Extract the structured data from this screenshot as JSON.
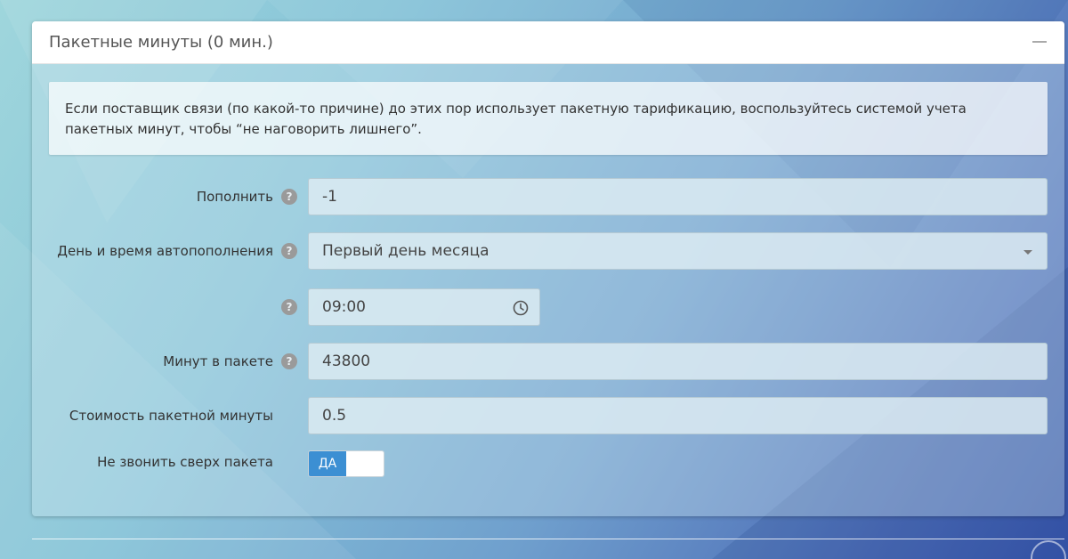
{
  "panel": {
    "title": "Пакетные минуты (0 мин.)",
    "info_text": "Если поставщик связи (по какой-то причине) до этих пор использует пакетную тарификацию, воспользуйтесь системой учета пакетных минут, чтобы “не наговорить лишнего”."
  },
  "form": {
    "replenish": {
      "label": "Пополнить",
      "value": "-1"
    },
    "auto_replenish": {
      "label": "День и время автопополнения",
      "value": "Первый день месяца"
    },
    "time": {
      "value": "09:00"
    },
    "minutes_in_package": {
      "label": "Минут в пакете",
      "value": "43800"
    },
    "minute_cost": {
      "label": "Стоимость пакетной минуты",
      "value": "0.5"
    },
    "no_call_over": {
      "label": "Не звонить сверх пакета",
      "toggle_label": "ДА",
      "on": true
    }
  },
  "icons": {
    "help": "question-circle-icon",
    "clock": "clock-icon",
    "collapse": "minus-icon",
    "scroll_up": "arrow-up-circle-icon"
  },
  "colors": {
    "toggle_on": "#3c8fd3"
  }
}
